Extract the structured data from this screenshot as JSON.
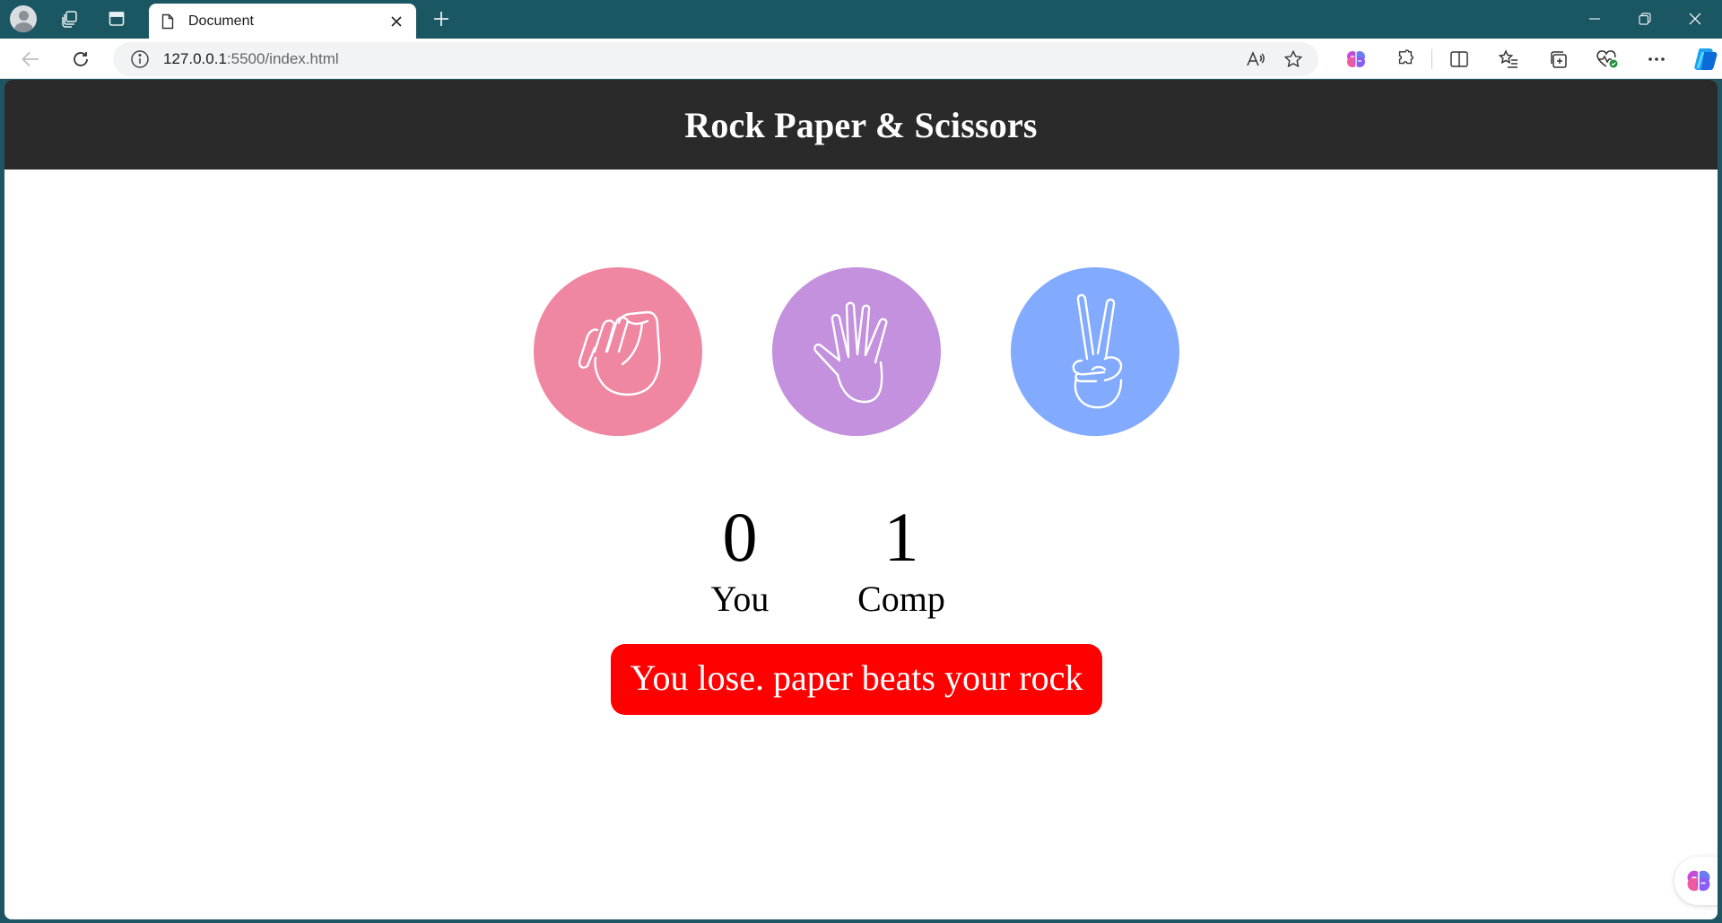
{
  "browser": {
    "tab_title": "Document",
    "url_host": "127.0.0.1",
    "url_path": ":5500/index.html"
  },
  "page": {
    "title": "Rock Paper & Scissors",
    "choices": [
      {
        "name": "rock",
        "color": "#ef87a2"
      },
      {
        "name": "paper",
        "color": "#c391dd"
      },
      {
        "name": "scissors",
        "color": "#82aafe"
      }
    ],
    "score": {
      "you_value": "0",
      "you_label": "You",
      "comp_value": "1",
      "comp_label": "Comp"
    },
    "message": "You lose. paper beats your rock",
    "message_color": "#ff0000"
  }
}
